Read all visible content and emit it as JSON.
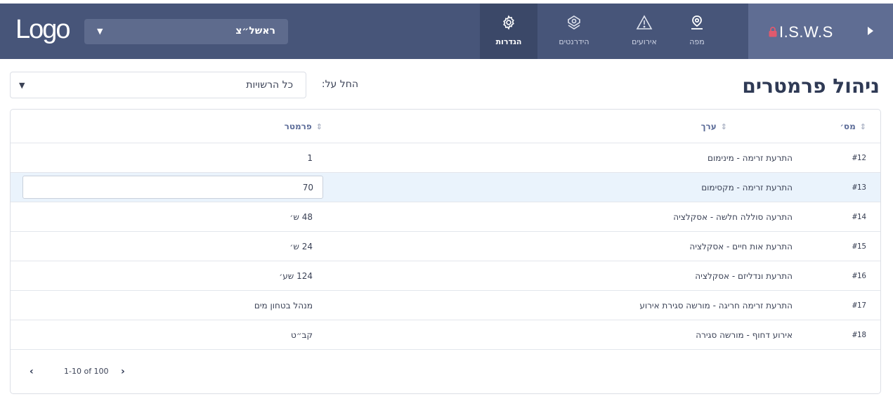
{
  "header": {
    "logo_text": "Logo",
    "city_select": {
      "value": "ראשל״צ",
      "caret_icon": "caret-down-icon"
    },
    "nav": [
      {
        "key": "settings",
        "label": "הגדרות",
        "icon": "gear-icon",
        "active": true
      },
      {
        "key": "hydrants",
        "label": "הידרנטים",
        "icon": "hydrant-icon",
        "active": false
      },
      {
        "key": "events",
        "label": "אירועים",
        "icon": "warning-icon",
        "active": false
      },
      {
        "key": "map",
        "label": "מפה",
        "icon": "map-pin-icon",
        "active": false
      }
    ],
    "brand": {
      "name": "I.S.W.S",
      "lock_icon": "lock-icon",
      "arrow_icon": "play-arrow-icon"
    },
    "colors": {
      "bar": "#475579",
      "active_tab": "#3b4868",
      "brand_bg": "#5f6d93",
      "lock": "#e05a6e"
    }
  },
  "page": {
    "title": "ניהול פרמטרים",
    "filter_label": "החל על:",
    "filter_value": "כל הרשויות"
  },
  "table": {
    "columns": {
      "num": "מס׳",
      "value": "ערך",
      "param": "פרמטר"
    },
    "rows": [
      {
        "num": "#12",
        "value": "התרעת זרימה - מינימום",
        "param": "1",
        "editing": false
      },
      {
        "num": "#13",
        "value": "התרעת זרימה - מקסימום",
        "param": "70",
        "editing": true
      },
      {
        "num": "#14",
        "value": "התרעה סוללה חלשה - אסקלציה",
        "param": "48 ש׳",
        "editing": false
      },
      {
        "num": "#15",
        "value": "התרעת אות חיים - אסקלציה",
        "param": "24 ש׳",
        "editing": false
      },
      {
        "num": "#16",
        "value": "התרעת ונדליזם - אסקלציה",
        "param": "124 שע׳",
        "editing": false
      },
      {
        "num": "#17",
        "value": "התרעת זרימה חריגה - מורשה סגירת אירוע",
        "param": "מנהל בטחון מים",
        "editing": false
      },
      {
        "num": "#18",
        "value": "אירוע דחוף - מורשה סגירה",
        "param": "קב״ט",
        "editing": false
      }
    ],
    "pagination": {
      "range": "1-10 of 100",
      "prev_icon": "chevron-left-icon",
      "next_icon": "chevron-right-icon"
    },
    "selected_row_color": "#eaf3fc"
  }
}
